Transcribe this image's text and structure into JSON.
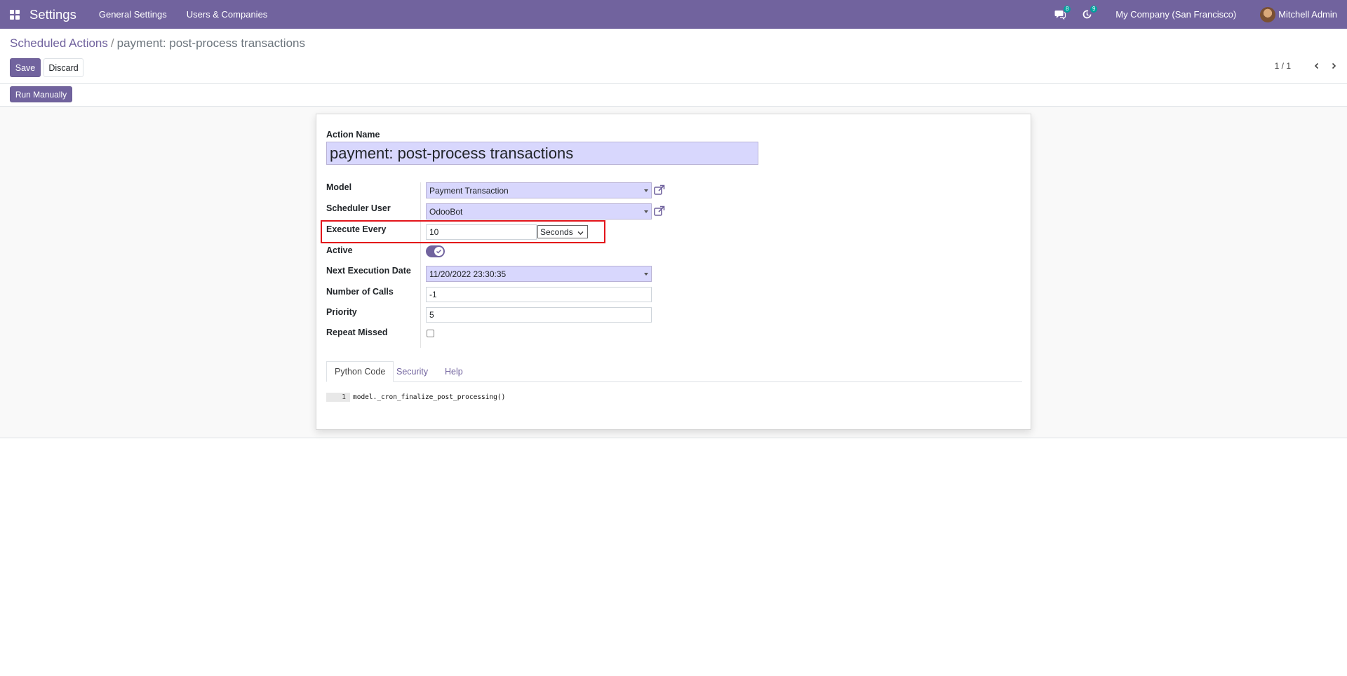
{
  "navbar": {
    "app_title": "Settings",
    "menu": [
      "General Settings",
      "Users & Companies"
    ],
    "messages_count": "8",
    "activities_count": "9",
    "company": "My Company (San Francisco)",
    "user": "Mitchell Admin"
  },
  "breadcrumb": {
    "parent": "Scheduled Actions",
    "separator": "/",
    "current": "payment: post-process transactions"
  },
  "actions": {
    "save": "Save",
    "discard": "Discard",
    "run_manually": "Run Manually"
  },
  "pager": {
    "value": "1 / 1"
  },
  "form": {
    "action_name_label": "Action Name",
    "action_name": "payment: post-process transactions",
    "model_label": "Model",
    "model": "Payment Transaction",
    "scheduler_user_label": "Scheduler User",
    "scheduler_user": "OdooBot",
    "execute_every_label": "Execute Every",
    "execute_every_value": "10",
    "execute_every_unit": "Seconds",
    "active_label": "Active",
    "active": true,
    "next_execution_label": "Next Execution Date",
    "next_execution": "11/20/2022 23:30:35",
    "number_of_calls_label": "Number of Calls",
    "number_of_calls": "-1",
    "priority_label": "Priority",
    "priority": "5",
    "repeat_missed_label": "Repeat Missed",
    "repeat_missed": false
  },
  "tabs": [
    "Python Code",
    "Security",
    "Help"
  ],
  "code": {
    "line_number": "1",
    "line": "model._cron_finalize_post_processing()"
  },
  "colors": {
    "brand": "#71639e",
    "highlight": "#e3141a",
    "field_bg": "#d8d7fd",
    "badge": "#00a09d"
  }
}
